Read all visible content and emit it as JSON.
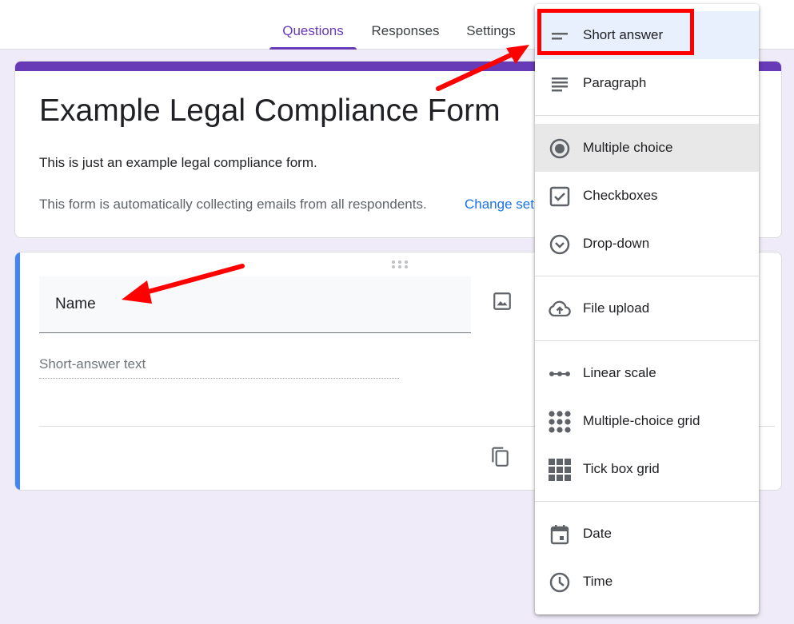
{
  "tabs": {
    "questions": "Questions",
    "responses": "Responses",
    "settings": "Settings"
  },
  "header": {
    "title": "Example Legal Compliance Form",
    "description": "This is just an example legal compliance form.",
    "email_note": "This form is automatically collecting emails from all respondents.",
    "change_link": "Change set"
  },
  "question": {
    "title": "Name",
    "answer_placeholder": "Short-answer text"
  },
  "menu": {
    "short_answer": "Short answer",
    "paragraph": "Paragraph",
    "multiple_choice": "Multiple choice",
    "checkboxes": "Checkboxes",
    "dropdown": "Drop-down",
    "file_upload": "File upload",
    "linear_scale": "Linear scale",
    "mc_grid": "Multiple-choice grid",
    "tick_grid": "Tick box grid",
    "date": "Date",
    "time": "Time"
  },
  "colors": {
    "accent": "#673ab7",
    "question_bar": "#4285f4",
    "annotation": "#ff0000",
    "link": "#1a73e8"
  }
}
